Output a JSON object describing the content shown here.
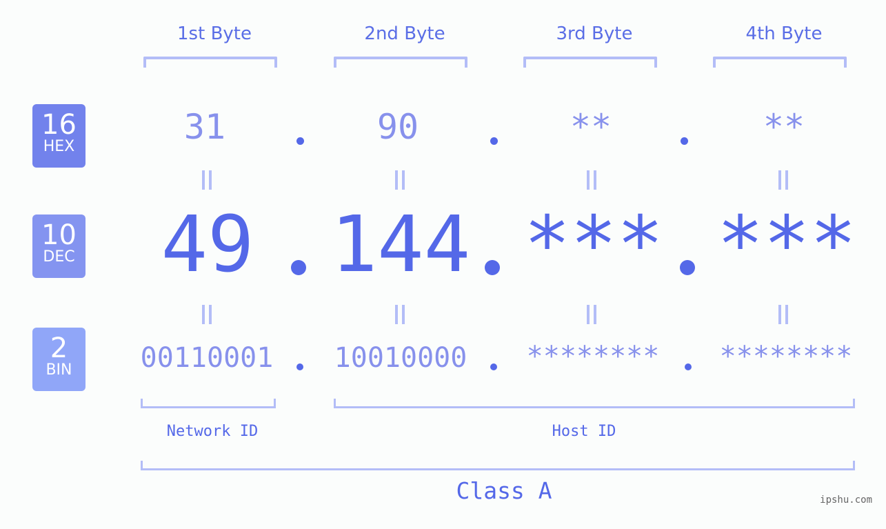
{
  "bytes": [
    {
      "header": "1st Byte",
      "hex": "31",
      "dec": "49",
      "bin": "00110001"
    },
    {
      "header": "2nd Byte",
      "hex": "90",
      "dec": "144",
      "bin": "10010000"
    },
    {
      "header": "3rd Byte",
      "hex": "**",
      "dec": "***",
      "bin": "********"
    },
    {
      "header": "4th Byte",
      "hex": "**",
      "dec": "***",
      "bin": "********"
    }
  ],
  "badges": {
    "hex": {
      "number": "16",
      "label": "HEX",
      "color": "#7282ec"
    },
    "dec": {
      "number": "10",
      "label": "DEC",
      "color": "#8494f0"
    },
    "bin": {
      "number": "2",
      "label": "BIN",
      "color": "#90a6f8"
    }
  },
  "segments": {
    "network_label": "Network ID",
    "host_label": "Host ID",
    "class_label": "Class A"
  },
  "watermark": "ipshu.com",
  "colors": {
    "primary": "#5468e8",
    "secondary": "#8791ec",
    "bracket": "#b3bdf7"
  }
}
